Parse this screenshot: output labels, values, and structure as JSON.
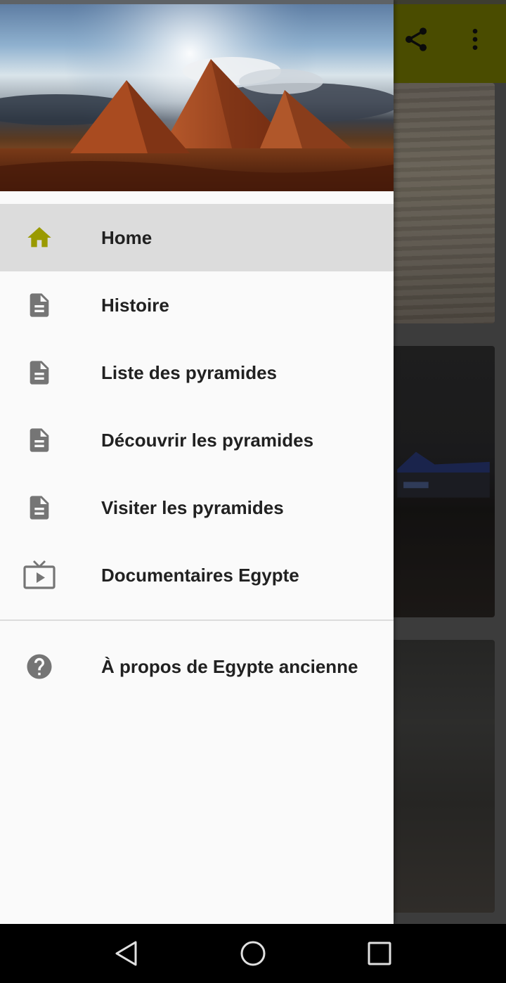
{
  "app_bar": {
    "color": "#727500",
    "actions": [
      {
        "icon": "share-icon"
      },
      {
        "icon": "more-vert-icon"
      }
    ]
  },
  "drawer": {
    "header_image": "pyramids-of-giza",
    "items": [
      {
        "label": "Home",
        "icon": "home-icon",
        "selected": true
      },
      {
        "label": "Histoire",
        "icon": "document-icon",
        "selected": false
      },
      {
        "label": "Liste des pyramides",
        "icon": "document-icon",
        "selected": false
      },
      {
        "label": "Découvrir les pyramides",
        "icon": "document-icon",
        "selected": false
      },
      {
        "label": "Visiter les pyramides",
        "icon": "document-icon",
        "selected": false
      },
      {
        "label": "Documentaires Egypte",
        "icon": "tv-play-icon",
        "selected": false
      }
    ],
    "secondary_items": [
      {
        "label": "À propos de Egypte ancienne",
        "icon": "help-circle-icon"
      }
    ],
    "accent_color": "#9a9a00",
    "icon_color": "#757575"
  },
  "navbar": {
    "buttons": [
      {
        "icon": "back-icon"
      },
      {
        "icon": "home-circle-icon"
      },
      {
        "icon": "recents-icon"
      }
    ]
  }
}
